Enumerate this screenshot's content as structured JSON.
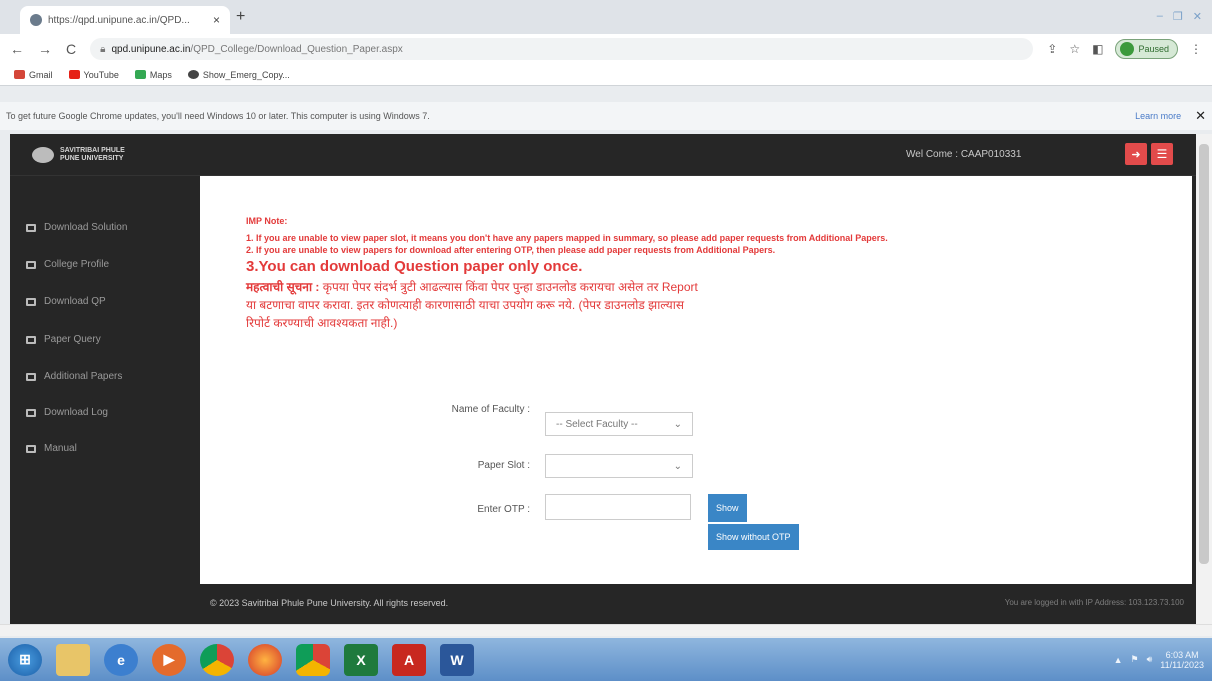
{
  "browser": {
    "tab_title": "https://qpd.unipune.ac.in/QPD...",
    "tab_close": "×",
    "new_tab": "+",
    "window_controls": [
      "–",
      "❐",
      "✕"
    ],
    "address_domain": "qpd.unipune.ac.in",
    "address_path": "/QPD_College/Download_Question_Paper.aspx",
    "profile_status": "Paused",
    "bookmarks": [
      {
        "label": "Gmail",
        "color": "#d44638"
      },
      {
        "label": "YouTube",
        "color": "#e62117"
      },
      {
        "label": "Maps",
        "color": "#34a853"
      },
      {
        "label": "Show_Emerg_Copy...",
        "color": "#444444"
      }
    ],
    "update_bar": {
      "message": "To get future Google Chrome updates, you'll need Windows 10 or later. This computer is using Windows 7.",
      "link": "Learn more",
      "close": "✕"
    }
  },
  "site": {
    "university_name": "SAVITRIBAI PHULE PUNE UNIVERSITY",
    "welcome": "Wel Come : CAAP010331",
    "colors": {
      "header": "#262626",
      "accent_red": "#e24b4b",
      "button_blue": "#3a86c6",
      "note_red": "#e33a3a"
    }
  },
  "sidebar": {
    "items": [
      {
        "label": "Download Solution"
      },
      {
        "label": "College Profile"
      },
      {
        "label": "Download QP"
      },
      {
        "label": "Paper Query"
      },
      {
        "label": "Additional Papers"
      },
      {
        "label": "Download Log"
      },
      {
        "label": "Manual"
      }
    ]
  },
  "note": {
    "heading": "IMP Note:",
    "line1": "1. If you are unable to view paper slot, it means you don't have any papers mapped in summary, so please add paper requests from Additional Papers.",
    "line2": "2. If you are unable to view papers for download after entering OTP, then please add paper requests from Additional Papers.",
    "line3": "3.You can download Question paper only once.",
    "marathi_prefix": "महत्वाची सूचना :",
    "marathi_body": "कृपया पेपर संदर्भ त्रुटी आढल्यास किंवा पेपर पुन्हा डाउनलोड करायचा असेल तर Report या बटणाचा वापर करावा. इतर कोणत्याही कारणासाठी याचा उपयोग करू नये. (पेपर डाउनलोड झाल्यास रिपोर्ट करण्याची आवश्यकता नाही.)"
  },
  "form": {
    "faculty_label": "Name of Faculty :",
    "faculty_value": "-- Select Faculty --",
    "slot_label": "Paper Slot :",
    "slot_value": "",
    "otp_label": "Enter OTP :",
    "otp_value": "",
    "show_button": "Show",
    "show_without_otp_button": "Show without OTP"
  },
  "footer": {
    "copyright": "© 2023 Savitribai Phule Pune University. All rights reserved.",
    "ip_info": "You are logged in with IP Address: 103.123.73.100"
  },
  "taskbar": {
    "clock_time": "6:03 AM",
    "clock_date": "11/11/2023"
  }
}
